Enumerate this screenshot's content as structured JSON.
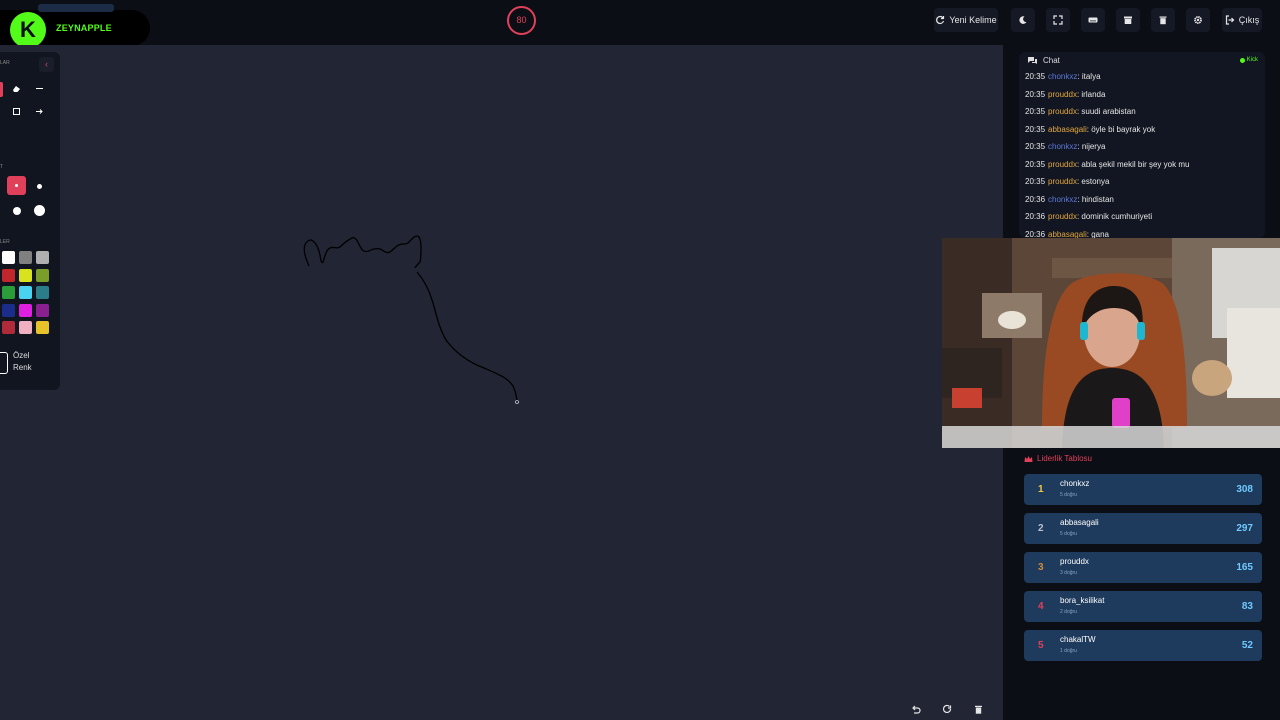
{
  "header": {
    "username": "ZEYNAPPLE",
    "logo_letter": "K",
    "timer": "80",
    "buttons": {
      "new_word": "Yeni Kelime",
      "logout": "Çıkış"
    }
  },
  "tools": {
    "section_label_1": "LAR",
    "section_label_2": "T",
    "section_label_3": "LER",
    "custom_color_label": "Özel Renk",
    "palette": [
      "#ffffff",
      "#808080",
      "#b0b0b0",
      "#c0262b",
      "#d9e21f",
      "#7b9d2a",
      "#2a9d3a",
      "#49d3f0",
      "#2b7d8a",
      "#1a2d8a",
      "#e020e0",
      "#8a2090",
      "#b02a3a",
      "#f0b0c0",
      "#e8c22a"
    ]
  },
  "chat": {
    "title": "Chat",
    "source": "Kick",
    "messages": [
      {
        "time": "20:35",
        "user": "chonkxz",
        "text": "italya",
        "cls": "u-chon"
      },
      {
        "time": "20:35",
        "user": "prouddx",
        "text": "irlanda",
        "cls": "u-proud"
      },
      {
        "time": "20:35",
        "user": "prouddx",
        "text": "suudi arabistan",
        "cls": "u-proud"
      },
      {
        "time": "20:35",
        "user": "abbasagali",
        "text": "öyle bi bayrak yok",
        "cls": "u-abbas"
      },
      {
        "time": "20:35",
        "user": "chonkxz",
        "text": "nijerya",
        "cls": "u-chon"
      },
      {
        "time": "20:35",
        "user": "prouddx",
        "text": "abla şekil mekil bir şey yok mu",
        "cls": "u-proud"
      },
      {
        "time": "20:35",
        "user": "prouddx",
        "text": "estonya",
        "cls": "u-proud"
      },
      {
        "time": "20:36",
        "user": "chonkxz",
        "text": "hindistan",
        "cls": "u-chon"
      },
      {
        "time": "20:36",
        "user": "prouddx",
        "text": "dominik cumhuriyeti",
        "cls": "u-proud"
      },
      {
        "time": "20:36",
        "user": "abbasagali",
        "text": "gana",
        "cls": "u-abbas"
      }
    ]
  },
  "leaderboard": {
    "title": "Liderlik Tablosu",
    "rows": [
      {
        "rank": "1",
        "user": "chonkxz",
        "sub": "5 doğru",
        "score": "308",
        "color": "#f2c744"
      },
      {
        "rank": "2",
        "user": "abbasagali",
        "sub": "5 doğru",
        "score": "297",
        "color": "#b8c0cc"
      },
      {
        "rank": "3",
        "user": "prouddx",
        "sub": "3 doğru",
        "score": "165",
        "color": "#d08a3a"
      },
      {
        "rank": "4",
        "user": "bora_ksilikat",
        "sub": "2 doğru",
        "score": "83",
        "color": "#e0405a"
      },
      {
        "rank": "5",
        "user": "chakalTW",
        "sub": "1 doğru",
        "score": "52",
        "color": "#e0405a"
      }
    ]
  }
}
